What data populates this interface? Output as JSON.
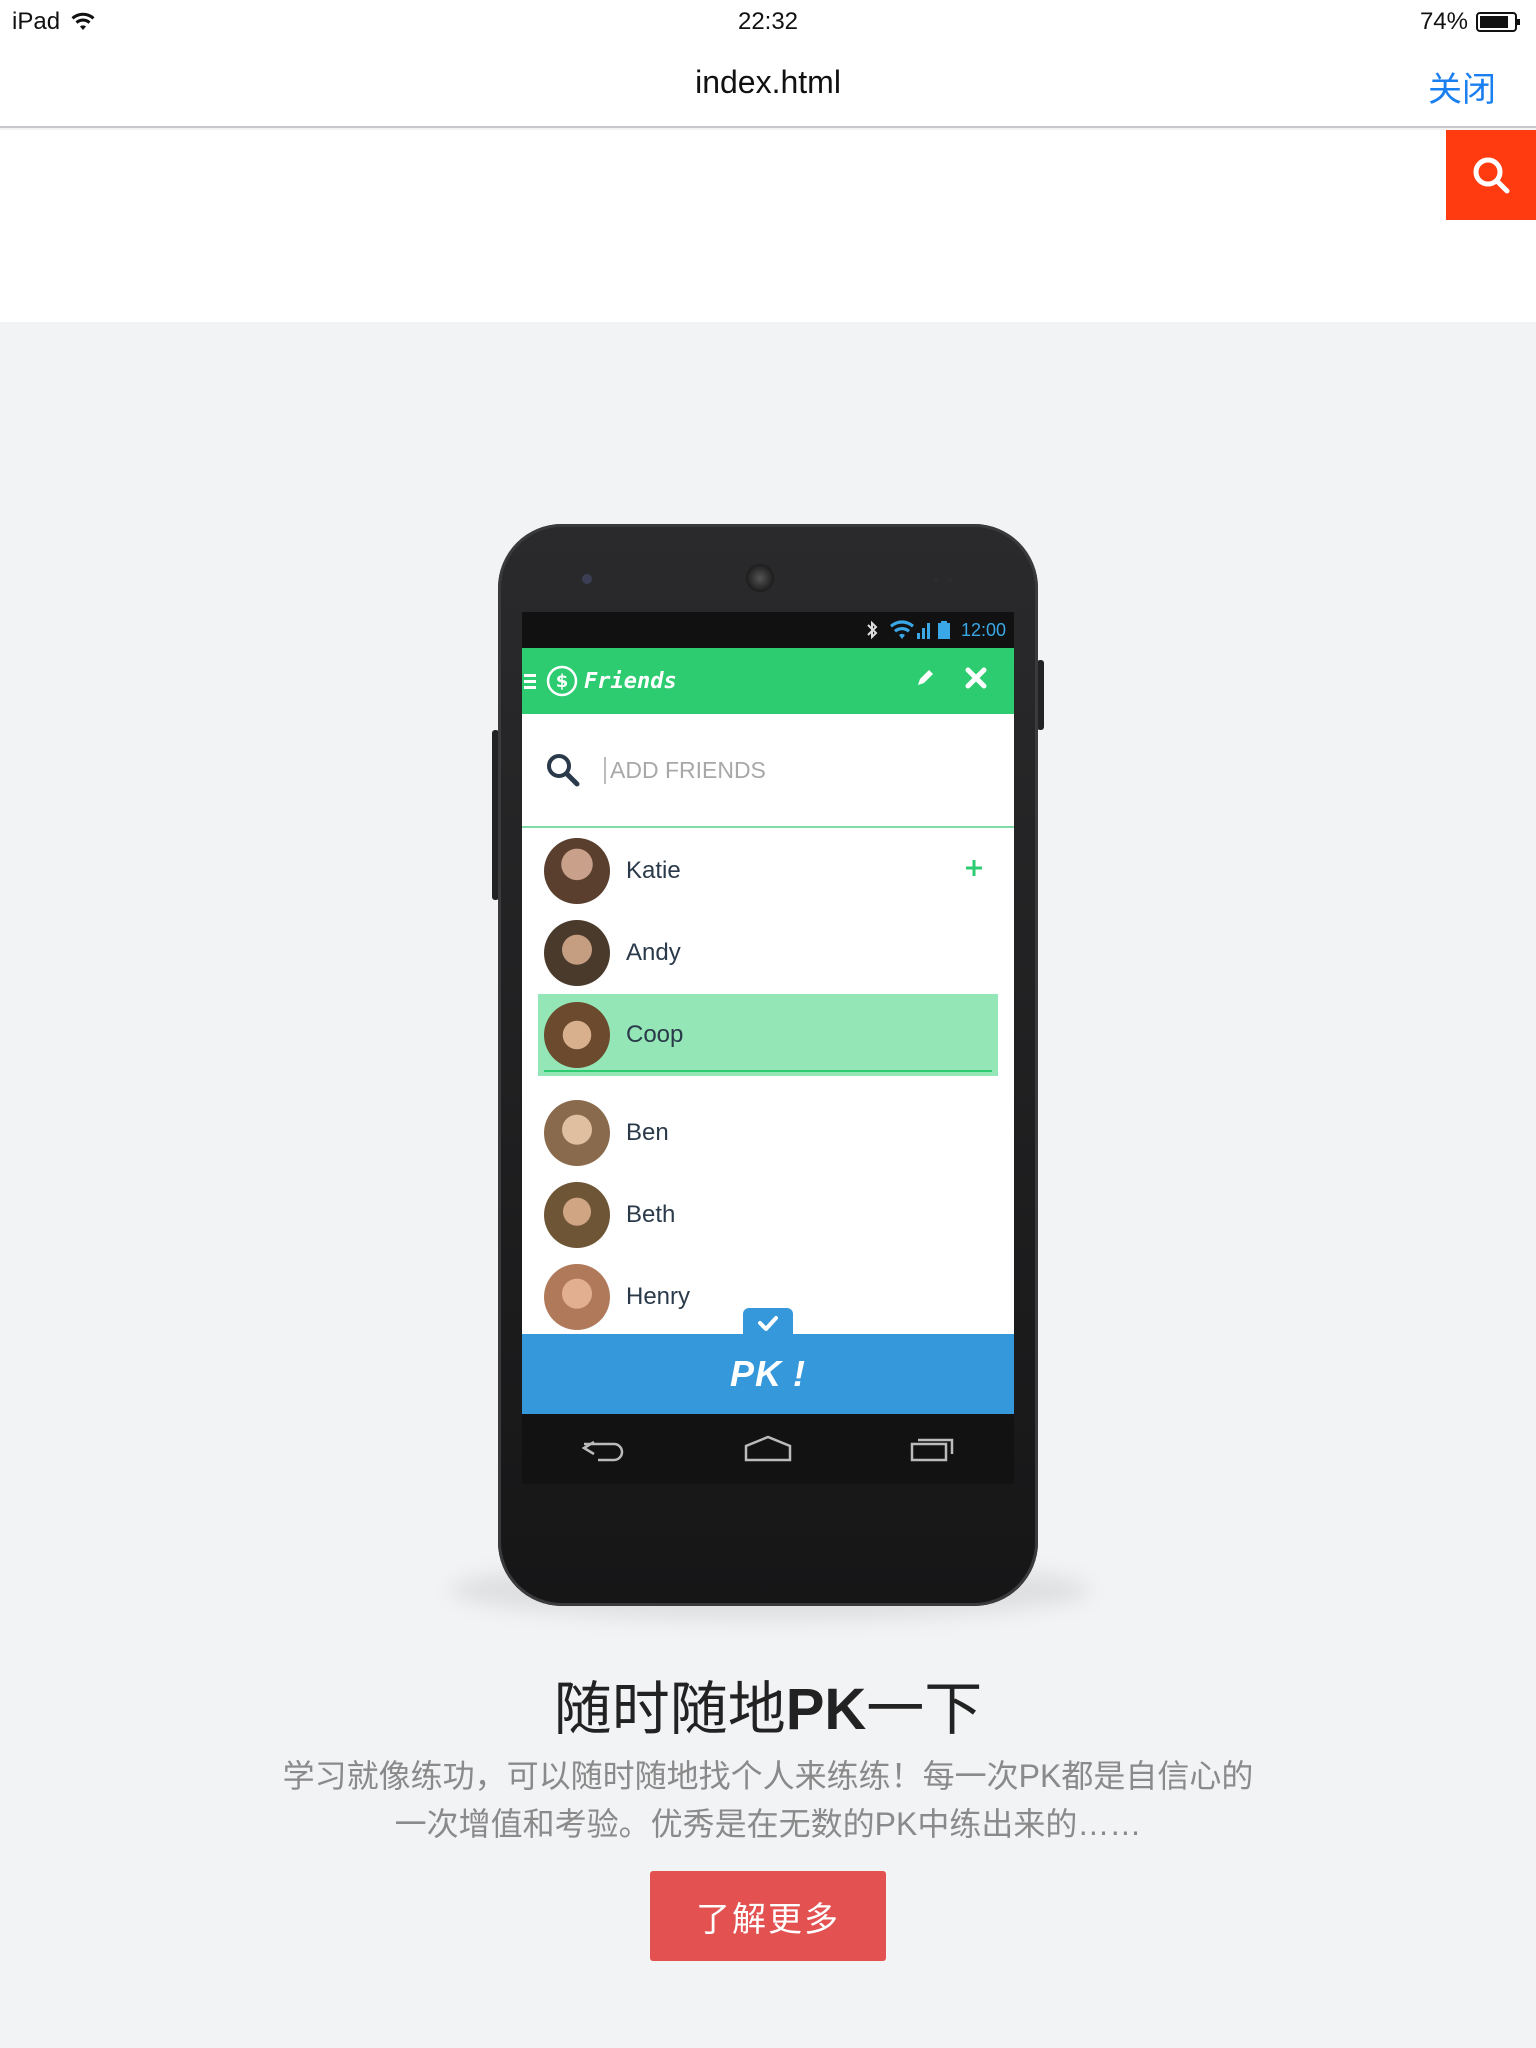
{
  "status_bar": {
    "device": "iPad",
    "time": "22:32",
    "battery": "74%"
  },
  "browser": {
    "page_title": "index.html",
    "close_label": "关闭"
  },
  "phone_app": {
    "clock": "12:00",
    "title": "Friends",
    "search_placeholder": "ADD FRIENDS",
    "friends": [
      {
        "name": "Katie",
        "avatar_color": "#5a3e2e",
        "selected": false
      },
      {
        "name": "Andy",
        "avatar_color": "#4a3a2c",
        "selected": false
      },
      {
        "name": "Coop",
        "avatar_color": "#6b4a2e",
        "selected": true
      },
      {
        "name": "Ben",
        "avatar_color": "#8a6a4c",
        "selected": false
      },
      {
        "name": "Beth",
        "avatar_color": "#6e5536",
        "selected": false
      },
      {
        "name": "Henry",
        "avatar_color": "#b07a5a",
        "selected": false
      }
    ],
    "pk_label": "PK !"
  },
  "content": {
    "headline_pre": "随时随地",
    "headline_bold": "PK",
    "headline_post": "一下",
    "description": "学习就像练功，可以随时随地找个人来练练！每一次PK都是自信心的一次增值和考验。优秀是在无数的PK中练出来的……",
    "more_button": "了解更多"
  },
  "colors": {
    "accent_red": "#ff3b0f",
    "button_red": "#e35151",
    "app_green": "#2ecc71",
    "pk_blue": "#3498db",
    "link_blue": "#1a7ff0"
  }
}
